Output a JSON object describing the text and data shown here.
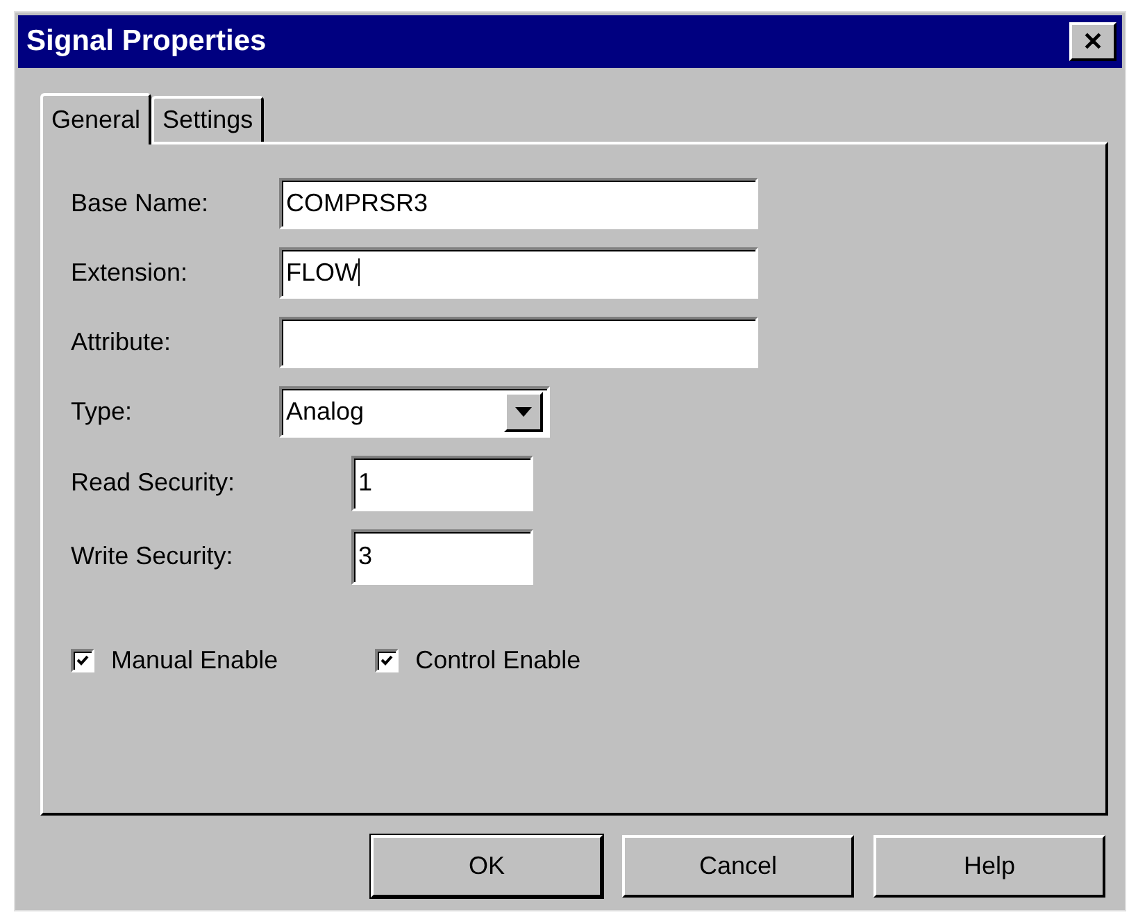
{
  "window": {
    "title": "Signal Properties",
    "close": "✕"
  },
  "tabs": [
    {
      "label": "General",
      "selected": true
    },
    {
      "label": "Settings",
      "selected": false
    }
  ],
  "fields": [
    {
      "kind": "text",
      "label": "Base Name:",
      "value": "COMPRSR3"
    },
    {
      "kind": "text",
      "label": "Extension:",
      "value": "FLOW",
      "focused": true
    },
    {
      "kind": "text",
      "label": "Attribute:"
    },
    {
      "kind": "select",
      "label": "Type:",
      "value": "Analog"
    },
    {
      "kind": "number",
      "label": "Read Security:",
      "value": "1"
    },
    {
      "kind": "number",
      "label": "Write Security:",
      "value": "3"
    }
  ],
  "checkboxes": [
    {
      "label": "Manual Enable",
      "checked": true
    },
    {
      "label": "Control Enable",
      "checked": true
    }
  ],
  "buttons": [
    {
      "label": "OK",
      "default": true
    },
    {
      "label": "Cancel",
      "default": false
    },
    {
      "label": "Help",
      "default": false
    }
  ]
}
